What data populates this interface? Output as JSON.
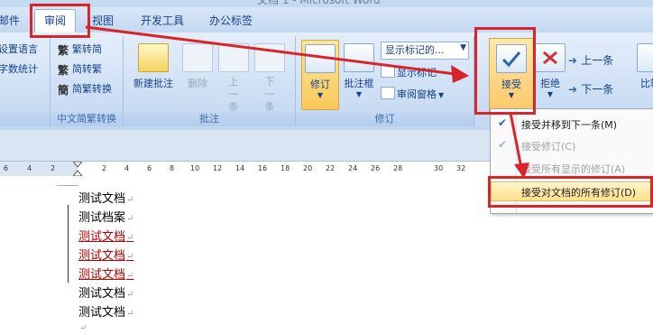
{
  "window": {
    "title": "文档 1 - Microsoft Word"
  },
  "tabs": [
    {
      "label": "邮件"
    },
    {
      "label": "审阅"
    },
    {
      "label": "视图"
    },
    {
      "label": "开发工具"
    },
    {
      "label": "办公标签"
    }
  ],
  "ribbon": {
    "language_group": {
      "set_language": "设置语言",
      "word_count": "字数统计"
    },
    "chinese_conversion": {
      "label": "中文简繁转换",
      "trad_to_simp": "繁转简",
      "simp_to_trad": "简转繁",
      "conversion": "简繁转换"
    },
    "comments": {
      "label": "批注",
      "new": "新建批注",
      "delete": "删除",
      "prev": "上一条",
      "next": "下一条"
    },
    "tracking": {
      "label": "修订",
      "track_changes": "修订",
      "balloons": "批注框",
      "show_markup_state": "显示标记的...",
      "show_markup": "显示标记",
      "review_pane": "审阅窗格"
    },
    "changes": {
      "accept": "接受",
      "reject": "拒绝",
      "prev": "上一条",
      "next": "下一条",
      "compare": "比较"
    }
  },
  "accept_menu": {
    "items": [
      {
        "label": "接受并移到下一条(M)",
        "enabled": true
      },
      {
        "label": "接受修订(C)",
        "enabled": false
      },
      {
        "label": "接受所有显示的修订(A)",
        "enabled": false
      },
      {
        "label": "接受对文档的所有修订(D)",
        "enabled": true,
        "highlighted": true
      }
    ]
  },
  "ruler": {
    "ticks": [
      "6",
      "4",
      "2",
      "2",
      "4",
      "6",
      "8",
      "10",
      "12",
      "14",
      "16",
      "18",
      "20",
      "22",
      "24",
      "26",
      "28",
      "30",
      "32"
    ]
  },
  "document": {
    "lines": [
      {
        "text": "测试文档",
        "revised": false
      },
      {
        "text": "测试档案",
        "revised": false
      },
      {
        "text": "测试文档",
        "revised": true
      },
      {
        "text": "测试文档",
        "revised": true
      },
      {
        "text": "测试文档",
        "revised": true
      },
      {
        "text": "测试文档",
        "revised": false
      },
      {
        "text": "测试文档",
        "revised": false
      }
    ],
    "paragraph_mark": "↵"
  },
  "colors": {
    "annotation_red": "#d8252b",
    "revision_red": "#b00000",
    "ribbon_blue": "#15428b"
  }
}
